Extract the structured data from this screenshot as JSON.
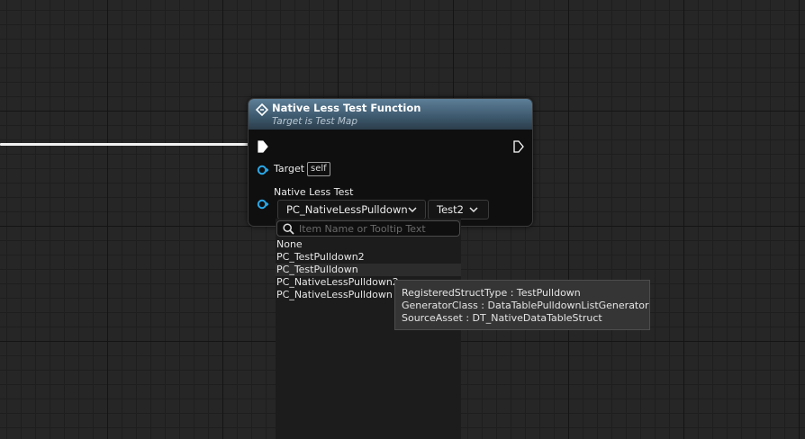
{
  "node": {
    "title": "Native Less Test Function",
    "subtitle": "Target is Test Map",
    "pins": {
      "target_label": "Target",
      "target_tag": "self",
      "native_label": "Native Less Test"
    },
    "combo_struct": "PC_NativeLessPulldown",
    "combo_row": "Test2"
  },
  "dropdown": {
    "search_placeholder": "Item Name or Tooltip Text",
    "items": [
      {
        "label": "None"
      },
      {
        "label": "PC_TestPulldown2"
      },
      {
        "label": "PC_TestPulldown"
      },
      {
        "label": "PC_NativeLessPulldown2"
      },
      {
        "label": "PC_NativeLessPulldown"
      }
    ]
  },
  "tooltip": {
    "lines": [
      "RegisteredStructType : TestPulldown",
      "GeneratorClass : DataTablePulldownListGenerator",
      "SourceAsset : DT_NativeDataTableStruct"
    ]
  },
  "colors": {
    "grid_bg": "#262626",
    "header_blue": "#4a6a82",
    "pin_blue": "#2aa8e8",
    "wire": "#f2f2f2"
  }
}
